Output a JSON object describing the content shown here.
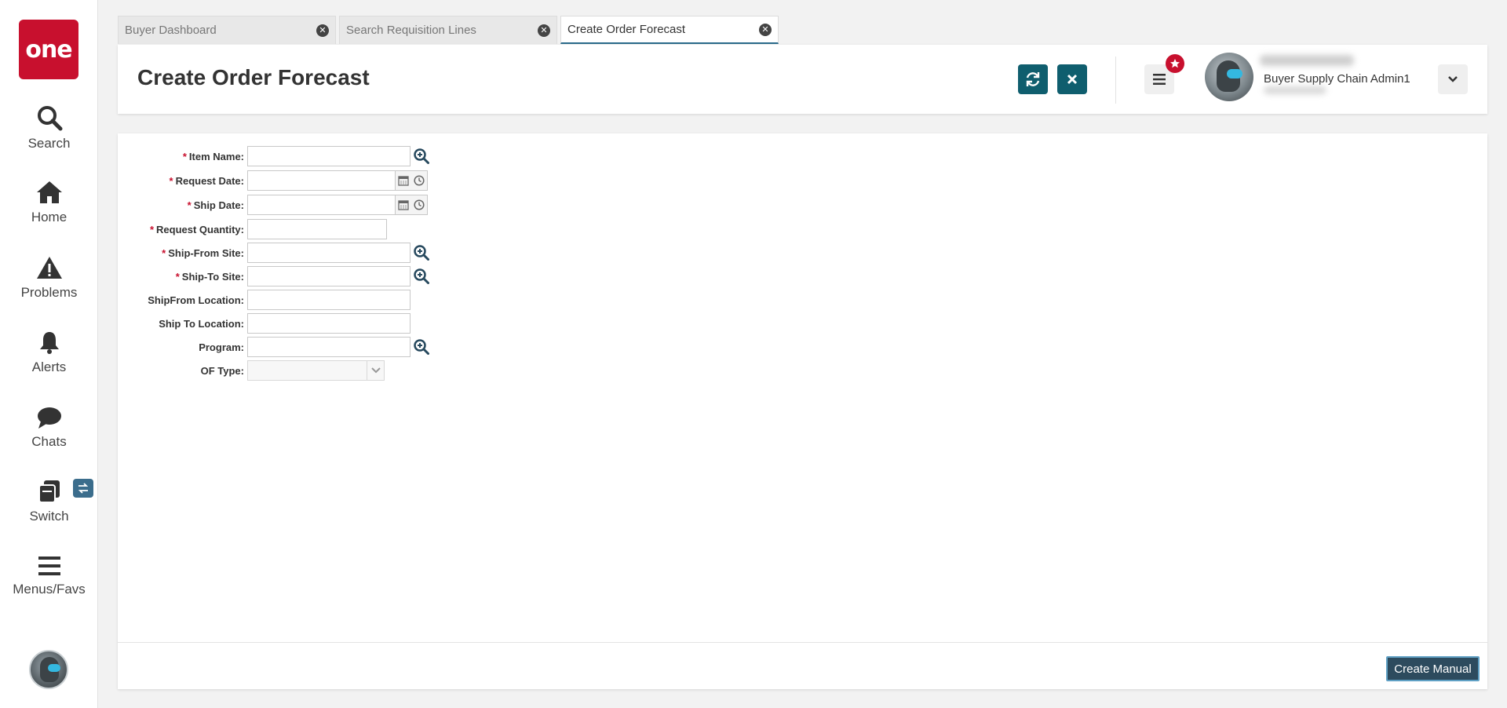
{
  "colors": {
    "brand": "#c8102e",
    "accent": "#0f5e6e",
    "primary_button": "#2d4b5e"
  },
  "sidebar": {
    "logo_text": "one",
    "items": [
      {
        "label": "Search",
        "icon": "search-icon"
      },
      {
        "label": "Home",
        "icon": "home-icon"
      },
      {
        "label": "Problems",
        "icon": "warning-icon"
      },
      {
        "label": "Alerts",
        "icon": "bell-icon"
      },
      {
        "label": "Chats",
        "icon": "chat-icon"
      },
      {
        "label": "Switch",
        "icon": "switch-icon"
      },
      {
        "label": "Menus/Favs",
        "icon": "hamburger-icon"
      }
    ]
  },
  "tabs": [
    {
      "label": "Buyer Dashboard",
      "active": false
    },
    {
      "label": "Search Requisition Lines",
      "active": false
    },
    {
      "label": "Create Order Forecast",
      "active": true
    }
  ],
  "header": {
    "title": "Create Order Forecast",
    "user_role": "Buyer Supply Chain Admin1"
  },
  "form": {
    "fields": [
      {
        "label": "Item Name:",
        "required": true,
        "value": ""
      },
      {
        "label": "Request Date:",
        "required": true,
        "value": ""
      },
      {
        "label": "Ship Date:",
        "required": true,
        "value": ""
      },
      {
        "label": "Request Quantity:",
        "required": true,
        "value": ""
      },
      {
        "label": "Ship-From Site:",
        "required": true,
        "value": ""
      },
      {
        "label": "Ship-To Site:",
        "required": true,
        "value": ""
      },
      {
        "label": "ShipFrom Location:",
        "required": false,
        "value": ""
      },
      {
        "label": "Ship To Location:",
        "required": false,
        "value": ""
      },
      {
        "label": "Program:",
        "required": false,
        "value": ""
      },
      {
        "label": "OF Type:",
        "required": false,
        "value": ""
      }
    ]
  },
  "actions": {
    "create_manual": "Create Manual"
  }
}
